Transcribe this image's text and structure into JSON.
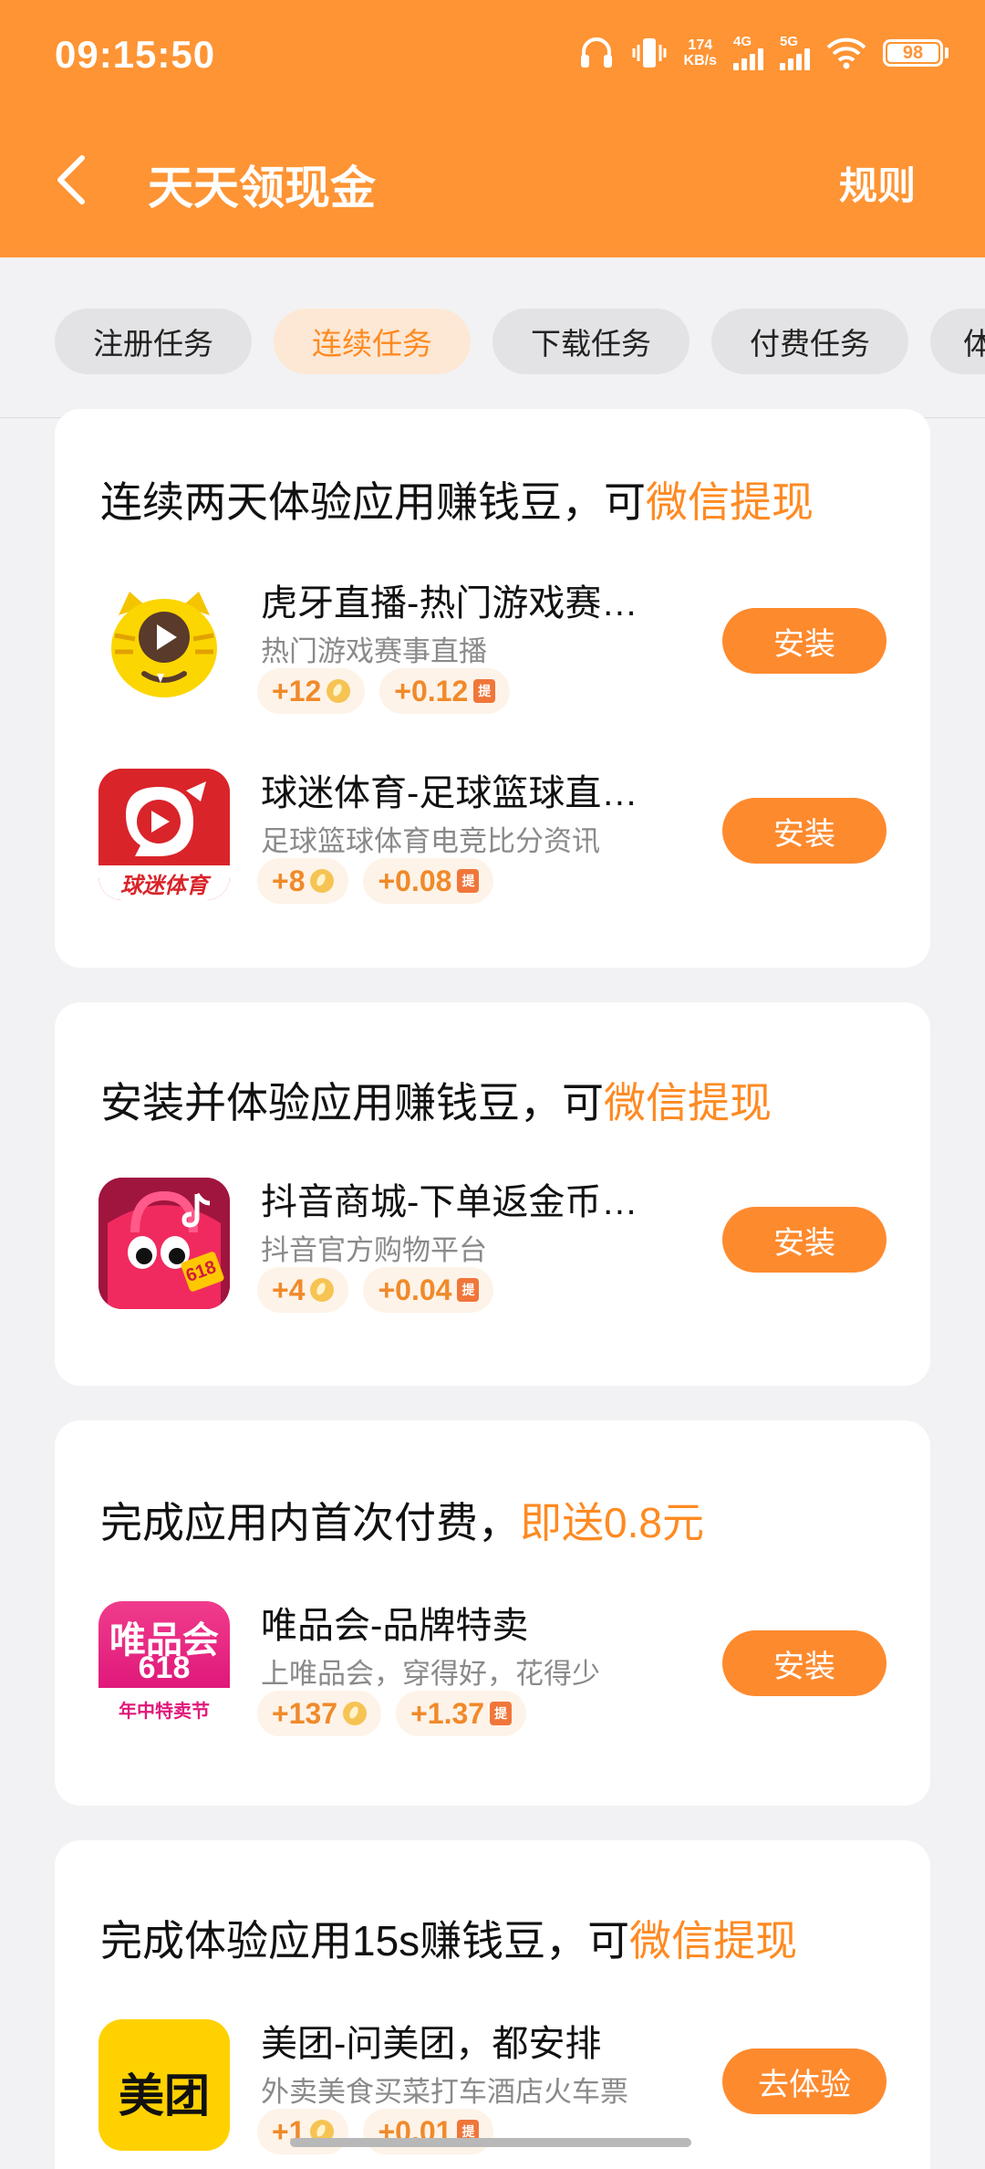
{
  "status_bar": {
    "time": "09:15:50",
    "net_speed_value": "174",
    "net_speed_unit": "KB/s",
    "sim1_label": "4G",
    "sim2_label": "5G",
    "battery": "98"
  },
  "header": {
    "title": "天天领现金",
    "rules": "规则"
  },
  "tabs": [
    {
      "label": "注册任务"
    },
    {
      "label": "连续任务"
    },
    {
      "label": "下载任务"
    },
    {
      "label": "付费任务"
    },
    {
      "label": "体"
    }
  ],
  "active_tab": "连续任务",
  "sections": [
    {
      "title": "连续两天体验应用赚钱豆，可",
      "highlight": "微信提现",
      "apps": [
        {
          "name": "虎牙直播-热门游戏赛…",
          "desc": "热门游戏赛事直播",
          "beans": "+12",
          "cash": "+0.12",
          "button": "安装",
          "icon": "huya-tiger-icon"
        },
        {
          "name": "球迷体育-足球篮球直…",
          "desc": "足球篮球体育电竞比分资讯",
          "beans": "+8",
          "cash": "+0.08",
          "button": "安装",
          "icon": "qiumi-sports-icon",
          "icon_text": "球迷体育"
        }
      ]
    },
    {
      "title": "安装并体验应用赚钱豆，可",
      "highlight": "微信提现",
      "apps": [
        {
          "name": "抖音商城-下单返金币…",
          "desc": "抖音官方购物平台",
          "beans": "+4",
          "cash": "+0.04",
          "button": "安装",
          "icon": "douyin-mall-icon",
          "icon_text": "618"
        }
      ]
    },
    {
      "title": "完成应用内首次付费，",
      "highlight": "即送0.8元",
      "apps": [
        {
          "name": "唯品会-品牌特卖",
          "desc": "上唯品会，穿得好，花得少",
          "beans": "+137",
          "cash": "+1.37",
          "button": "安装",
          "icon": "vipshop-icon",
          "icon_text_1": "唯品会",
          "icon_text_2": "618",
          "icon_text_3": "年中特卖节"
        }
      ]
    },
    {
      "title": "完成体验应用15s赚钱豆，可",
      "highlight": "微信提现",
      "apps": [
        {
          "name": "美团-问美团，都安排",
          "desc": "外卖美食买菜打车酒店火车票",
          "beans": "+1",
          "cash": "+0.01",
          "button": "去体验",
          "icon": "meituan-icon",
          "icon_text": "美团"
        }
      ]
    }
  ],
  "cash_badge_text": "提",
  "colors": {
    "header_bg": "#fe9434",
    "accent": "#fe8a22",
    "button_bg": "#fe8a2e",
    "reward_bg": "#fef3e8",
    "page_bg": "#f2f2f4"
  }
}
